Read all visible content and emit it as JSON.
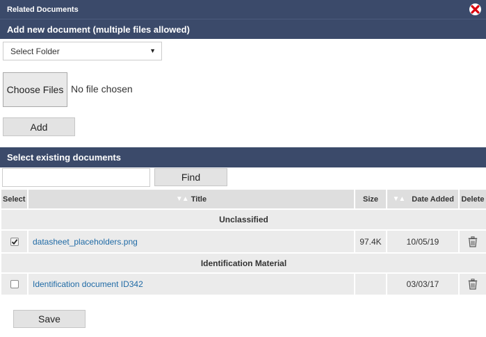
{
  "dialog": {
    "title": "Related Documents",
    "close_icon": "close-icon"
  },
  "add_section": {
    "heading": "Add new document (multiple files allowed)",
    "folder_select": {
      "value": "Select Folder"
    },
    "choose_files_label": "Choose Files",
    "no_file_text": "No file chosen",
    "add_label": "Add"
  },
  "existing_section": {
    "heading": "Select existing documents",
    "search_value": "",
    "find_label": "Find",
    "columns": [
      "Select",
      "Title",
      "Size",
      "Date Added",
      "Delete"
    ],
    "groups": [
      {
        "name": "Unclassified",
        "rows": [
          {
            "checked": true,
            "title": "datasheet_placeholders.png",
            "size": "97.4K",
            "date": "10/05/19"
          }
        ]
      },
      {
        "name": "Identification Material",
        "rows": [
          {
            "checked": false,
            "title": "Identification document ID342",
            "size": "",
            "date": "03/03/17"
          }
        ]
      }
    ]
  },
  "save_label": "Save",
  "colors": {
    "header_bar": "#3b4a6a",
    "link": "#1f6aa5",
    "close": "#d9000d"
  }
}
